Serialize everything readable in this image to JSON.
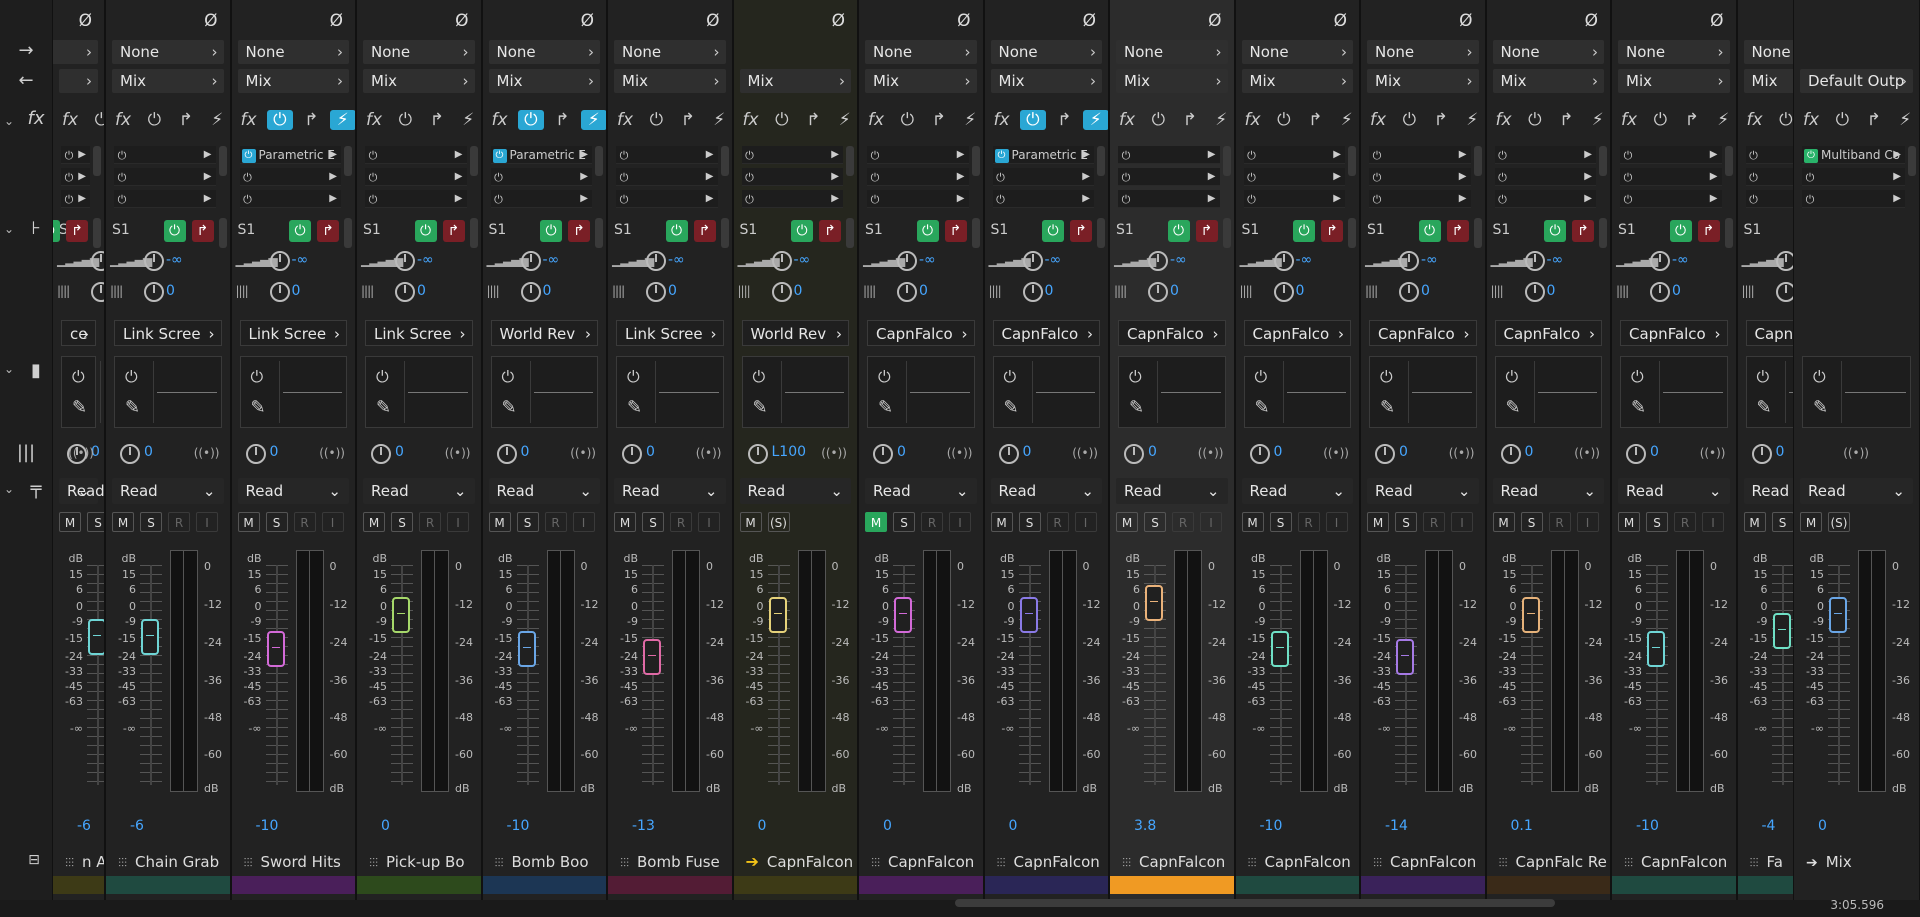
{
  "left_panel": {
    "rows": [
      "phase",
      "input-arrow",
      "output-arrow",
      "fx",
      "sends",
      "eq",
      "pan",
      "automation"
    ]
  },
  "common": {
    "phase": "Ø",
    "fx_label": "fx",
    "send_label": "S1",
    "send_vol": "-∞",
    "send_pan": "0",
    "pan_value": "0",
    "read": "Read",
    "m": "M",
    "s": "S",
    "r": "R",
    "i": "I",
    "scale_left": [
      "dB",
      "15",
      "6",
      "0",
      "-9",
      "-15",
      "-24",
      "-33",
      "-45",
      "-63",
      "-∞"
    ],
    "scale_right": [
      "0",
      "-12",
      "-24",
      "-36",
      "-48",
      "-60",
      "dB"
    ]
  },
  "strips": [
    {
      "name": "n Arro",
      "input": "",
      "output": "",
      "dest": "ce",
      "volume": "-6",
      "color": "#3d3a16",
      "fader_color": "#6fd6d6",
      "fader_pos": 0.36,
      "partial": true
    },
    {
      "name": "Chain Grab",
      "input": "None",
      "output": "Mix",
      "dest": "Link Scree",
      "volume": "-6",
      "color": "#1f4a40",
      "fader_color": "#6fd6d6",
      "fader_pos": 0.36,
      "fx": "",
      "fx_on": false
    },
    {
      "name": "Sword Hits",
      "input": "None",
      "output": "Mix",
      "dest": "Link Scree",
      "volume": "-10",
      "color": "#4a1f5a",
      "fader_color": "#d36ad8",
      "fader_pos": 0.42,
      "fx": "Parametric E",
      "fx_on": true
    },
    {
      "name": "Pick-up Bo",
      "input": "None",
      "output": "Mix",
      "dest": "Link Scree",
      "volume": "0",
      "color": "#2d4a1c",
      "fader_color": "#a6d86a",
      "fader_pos": 0.25,
      "fx": "",
      "fx_on": false
    },
    {
      "name": "Bomb Boo",
      "input": "None",
      "output": "Mix",
      "dest": "World Rev",
      "volume": "-10",
      "color": "#1c3654",
      "fader_color": "#6aa6e6",
      "fader_pos": 0.42,
      "fx": "Parametric E",
      "fx_on": true
    },
    {
      "name": "Bomb Fuse",
      "input": "None",
      "output": "Mix",
      "dest": "Link Scree",
      "volume": "-13",
      "color": "#531c35",
      "fader_color": "#e06aa6",
      "fader_pos": 0.46,
      "fx": "",
      "fx_on": false
    },
    {
      "name": "CapnFalcon",
      "input": "",
      "output": "Mix",
      "dest": "World Rev",
      "volume": "0",
      "color": "#3d3a16",
      "fader_color": "#e6d27a",
      "fader_pos": 0.25,
      "fx": "",
      "fx_on": false,
      "pan": "L100",
      "solo_paren": true,
      "bus": true
    },
    {
      "name": "CapnFalcon",
      "input": "None",
      "output": "Mix",
      "dest": "CapnFalco",
      "volume": "0",
      "color": "#4a1f5a",
      "fader_color": "#d36ad8",
      "fader_pos": 0.25,
      "fx": "",
      "fx_on": false,
      "mute_on": true
    },
    {
      "name": "CapnFalcon",
      "input": "None",
      "output": "Mix",
      "dest": "CapnFalco",
      "volume": "0",
      "color": "#2a2656",
      "fader_color": "#8a7ae6",
      "fader_pos": 0.25,
      "fx": "Parametric E",
      "fx_on": true
    },
    {
      "name": "CapnFalcon",
      "input": "None",
      "output": "Mix",
      "dest": "CapnFalco",
      "volume": "3.8",
      "color": "#f09a23",
      "fader_color": "#eab27a",
      "fader_pos": 0.19,
      "fx": "",
      "fx_on": false,
      "selected": true
    },
    {
      "name": "CapnFalcon",
      "input": "None",
      "output": "Mix",
      "dest": "CapnFalco",
      "volume": "-10",
      "color": "#1f4a40",
      "fader_color": "#6fe0c6",
      "fader_pos": 0.42,
      "fx": "",
      "fx_on": false
    },
    {
      "name": "CapnFalcon",
      "input": "None",
      "output": "Mix",
      "dest": "CapnFalco",
      "volume": "-14",
      "color": "#3a225a",
      "fader_color": "#a67ae6",
      "fader_pos": 0.46,
      "fx": "",
      "fx_on": false
    },
    {
      "name": "CapnFalc Re",
      "input": "None",
      "output": "Mix",
      "dest": "CapnFalco",
      "volume": "0.1",
      "color": "#3a2a18",
      "fader_color": "#e6b27a",
      "fader_pos": 0.25,
      "fx": "",
      "fx_on": false
    },
    {
      "name": "CapnFalcon",
      "input": "None",
      "output": "Mix",
      "dest": "CapnFalco",
      "volume": "-10",
      "color": "#1f4a40",
      "fader_color": "#6fd6d6",
      "fader_pos": 0.42,
      "fx": "",
      "fx_on": false
    },
    {
      "name": "Fa",
      "input": "None",
      "output": "Mix",
      "dest": "CapnFa",
      "volume": "-4",
      "color": "#1f4a40",
      "fader_color": "#6fe0c6",
      "fader_pos": 0.33,
      "fx": "",
      "fx_on": false,
      "partial": true
    }
  ],
  "master": {
    "name": "Mix",
    "output": "Default Outp",
    "fx": "Multiband Co",
    "volume": "0",
    "fader_color": "#6aa6e6",
    "fader_pos": 0.25
  },
  "timecode": "3:05.596"
}
